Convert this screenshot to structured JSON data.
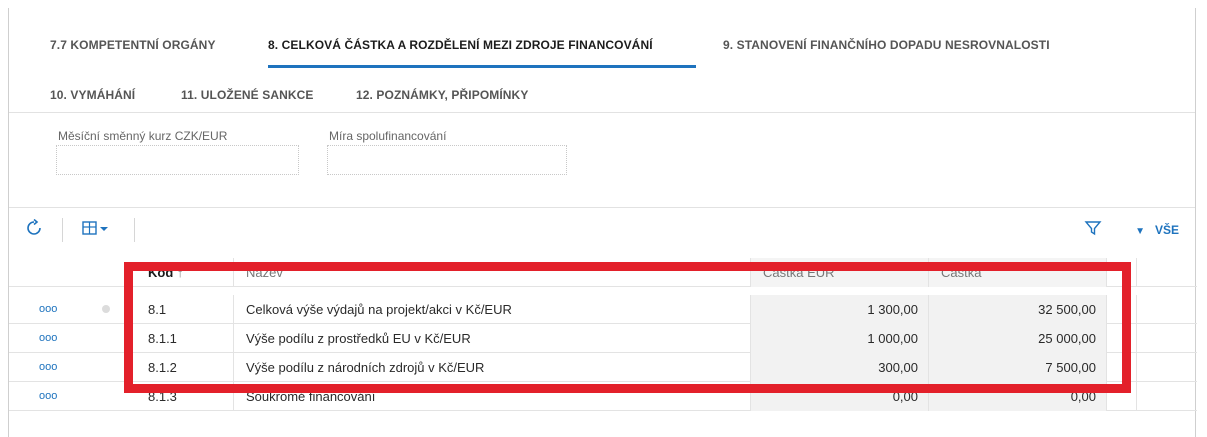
{
  "tabs": [
    {
      "label": "7.7 KOMPETENTNÍ ORGÁNY"
    },
    {
      "label": "8. CELKOVÁ ČÁSTKA A ROZDĚLENÍ MEZI ZDROJE FINANCOVÁNÍ"
    },
    {
      "label": "9. STANOVENÍ FINANČNÍHO DOPADU NESROVNALOSTI"
    },
    {
      "label": "10. VYMÁHÁNÍ"
    },
    {
      "label": "11. ULOŽENÉ SANKCE"
    },
    {
      "label": "12. POZNÁMKY, PŘIPOMÍNKY"
    }
  ],
  "active_tab": "8. CELKOVÁ ČÁSTKA A ROZDĚLENÍ MEZI ZDROJE FINANCOVÁNÍ",
  "fields": {
    "exchange_rate_label": "Měsíční směnný kurz CZK/EUR",
    "exchange_rate_value": "",
    "cofinancing_label": "Míra spolufinancování",
    "cofinancing_value": ""
  },
  "toolbar": {
    "refresh_icon": "refresh-icon",
    "export_icon": "export-icon",
    "filter_icon": "filter-icon",
    "all_label": "VŠE"
  },
  "table": {
    "columns": {
      "kod": "Kód",
      "nazev": "Název",
      "castka_eur": "Částka EUR",
      "castka": "Částka"
    },
    "rows": [
      {
        "dots": "ooo",
        "kod": "8.1",
        "nazev": "Celková výše výdajů na projekt/akci v Kč/EUR",
        "castka_eur": "1 300,00",
        "castka": "32 500,00"
      },
      {
        "dots": "ooo",
        "kod": "8.1.1",
        "nazev": "Výše podílu z prostředků EU v Kč/EUR",
        "castka_eur": "1 000,00",
        "castka": "25 000,00"
      },
      {
        "dots": "ooo",
        "kod": "8.1.2",
        "nazev": "Výše podílu z národních zdrojů v Kč/EUR",
        "castka_eur": "300,00",
        "castka": "7 500,00"
      },
      {
        "dots": "ooo",
        "kod": "8.1.3",
        "nazev": "Soukromé financování",
        "castka_eur": "0,00",
        "castka": "0,00"
      }
    ]
  },
  "colors": {
    "accent": "#1e73be",
    "highlight": "#e3202a"
  }
}
